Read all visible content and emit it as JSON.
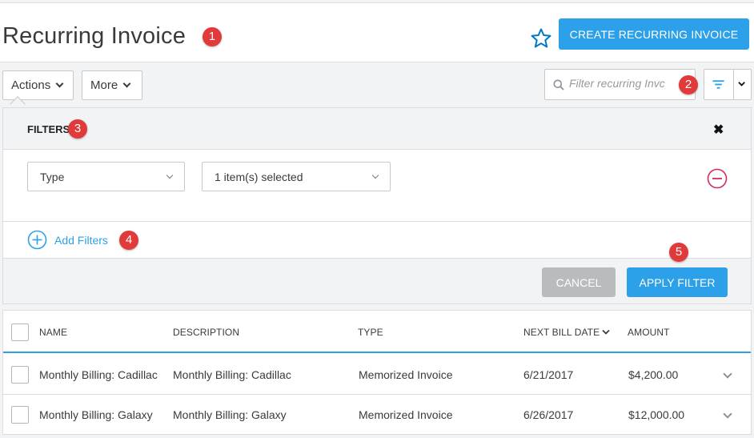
{
  "header": {
    "title": "Recurring Invoice",
    "create_label": "CREATE RECURRING INVOICE"
  },
  "badges": [
    "1",
    "2",
    "3",
    "4",
    "5"
  ],
  "toolbar": {
    "actions_label": "Actions",
    "more_label": "More",
    "search_placeholder": "Filter recurring Invc"
  },
  "filters": {
    "title": "FILTERS",
    "rows": [
      {
        "field": "Type",
        "value": "1 item(s) selected"
      }
    ],
    "add_label": "Add Filters",
    "cancel_label": "CANCEL",
    "apply_label": "APPLY FILTER"
  },
  "table": {
    "columns": [
      "NAME",
      "DESCRIPTION",
      "TYPE",
      "NEXT BILL DATE",
      "AMOUNT"
    ],
    "rows": [
      {
        "name": "Monthly Billing: Cadillac",
        "description": "Monthly Billing: Cadillac",
        "type": "Memorized Invoice",
        "next_bill_date": "6/21/2017",
        "amount": "$4,200.00"
      },
      {
        "name": "Monthly Billing: Galaxy",
        "description": "Monthly Billing: Galaxy",
        "type": "Memorized Invoice",
        "next_bill_date": "6/26/2017",
        "amount": "$12,000.00"
      }
    ]
  },
  "colors": {
    "accent": "#2ca0e8",
    "badge": "#e03a3a",
    "remove": "#d52b5a",
    "star": "#0077c5"
  },
  "icons": [
    "star-icon",
    "search-icon",
    "filter-icon",
    "chevron-down-icon",
    "close-icon",
    "remove-circle-icon",
    "add-circle-icon"
  ]
}
